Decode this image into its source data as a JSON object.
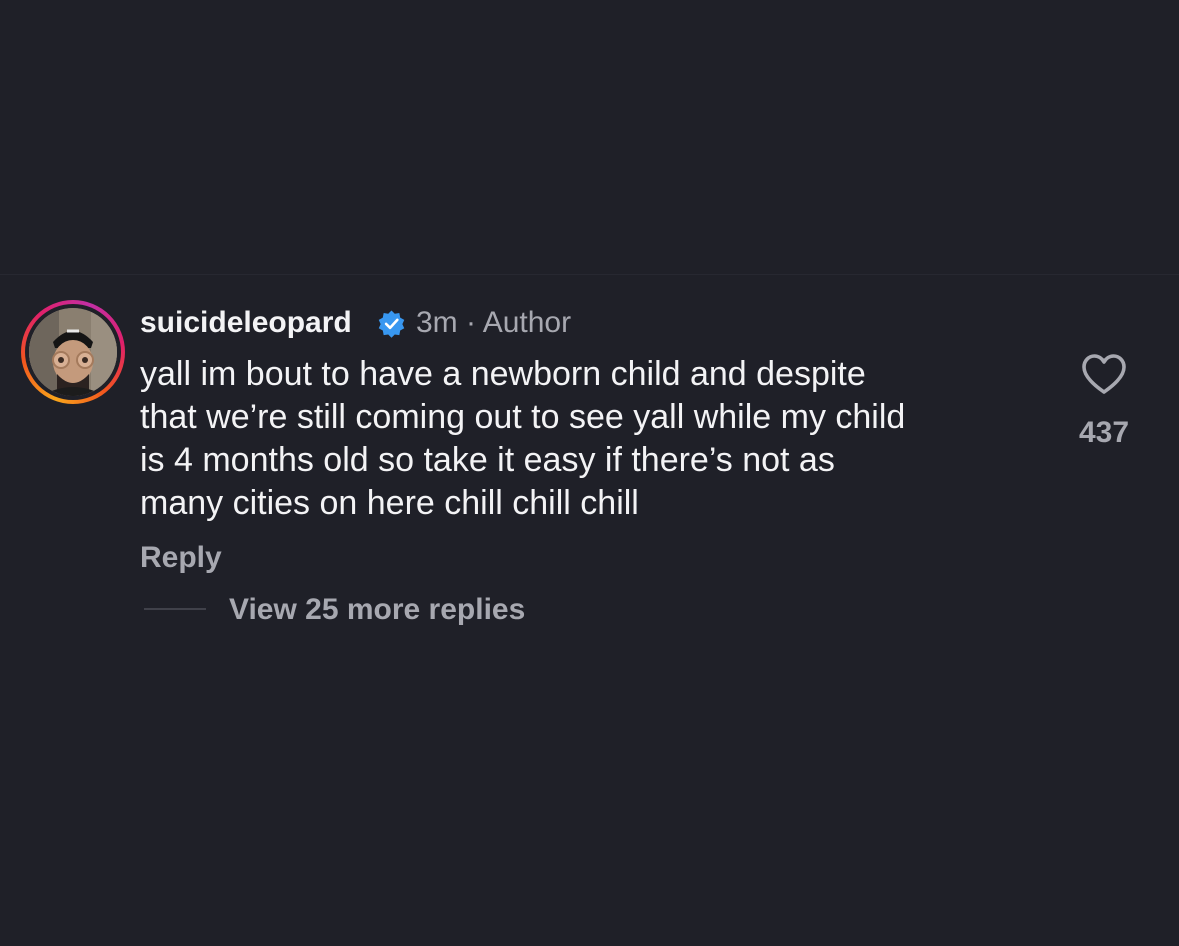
{
  "comment": {
    "username": "suicideleopard",
    "verified_icon": "verified-badge-icon",
    "time": "3m",
    "separator": "·",
    "author_tag": "Author",
    "body_lines": [
      "yall im bout to have a newborn child and despite",
      "that we’re still coming out to see yall while my child",
      "is 4 months old so take it easy if there’s not as",
      "many cities on here chill chill chill"
    ],
    "reply_label": "Reply",
    "view_replies_label": "View 25 more replies",
    "like_icon": "heart-icon",
    "like_count": "437"
  },
  "colors": {
    "background": "#1f2028",
    "primary_text": "#f3f3f5",
    "secondary_text": "#a7a8b0",
    "verified_blue": "#3897f0",
    "story_ring_gradient": [
      "#f9a51b",
      "#f2551f",
      "#e0206a",
      "#c22fa5"
    ]
  }
}
